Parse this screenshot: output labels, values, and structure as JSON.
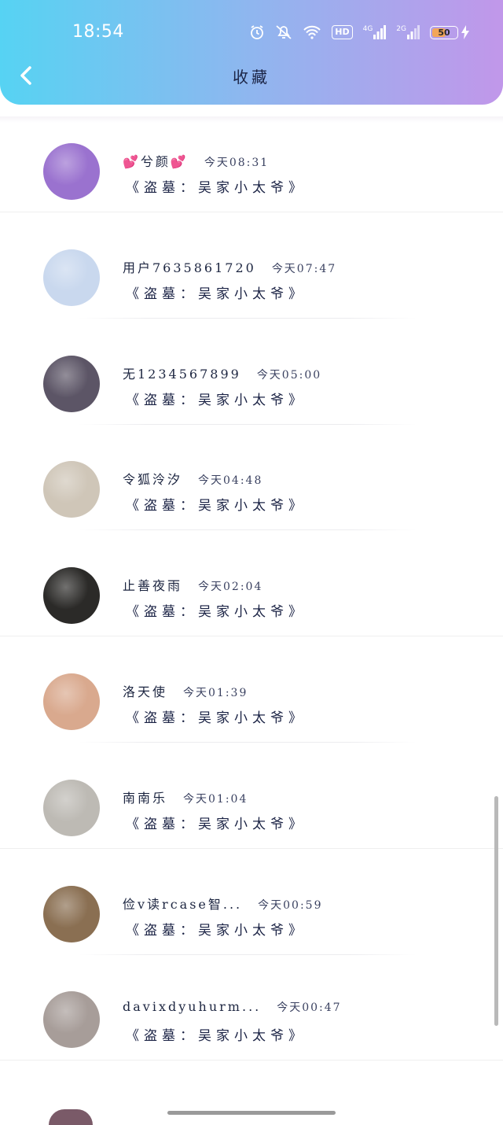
{
  "status_bar": {
    "time": "18:54",
    "network_4g": "4G",
    "network_2g": "2G",
    "hd": "HD",
    "battery": "50"
  },
  "header": {
    "title": "收藏",
    "back_icon": "chevron-left-icon"
  },
  "items": [
    {
      "name": "💕兮颜💕",
      "time": "今天08:31",
      "subtitle": "《盗墓：吴家小太爷》",
      "avatar_color": "#9a72cf"
    },
    {
      "name": "用户7635861720",
      "time": "今天07:47",
      "subtitle": "《盗墓：吴家小太爷》",
      "avatar_color": "#c9d8ee"
    },
    {
      "name": "无1234567899",
      "time": "今天05:00",
      "subtitle": "《盗墓：吴家小太爷》",
      "avatar_color": "#5c5566"
    },
    {
      "name": "令狐泠汐",
      "time": "今天04:48",
      "subtitle": "《盗墓：吴家小太爷》",
      "avatar_color": "#cfc6b8"
    },
    {
      "name": "止善夜雨",
      "time": "今天02:04",
      "subtitle": "《盗墓：吴家小太爷》",
      "avatar_color": "#2b2a28"
    },
    {
      "name": "洛天使",
      "time": "今天01:39",
      "subtitle": "《盗墓：吴家小太爷》",
      "avatar_color": "#d9a98e"
    },
    {
      "name": "南南乐",
      "time": "今天01:04",
      "subtitle": "《盗墓：吴家小太爷》",
      "avatar_color": "#bdbab4"
    },
    {
      "name": "俭v读rcase智...",
      "time": "今天00:59",
      "subtitle": "《盗墓：吴家小太爷》",
      "avatar_color": "#8a6f52"
    },
    {
      "name": "davixdyuhurm...",
      "time": "今天00:47",
      "subtitle": "《盗墓：吴家小太爷》",
      "avatar_color": "#a79d99"
    }
  ],
  "colors": {
    "header_gradient_start": "#56d3f3",
    "header_gradient_end": "#c197ea",
    "text": "#1c2540"
  }
}
